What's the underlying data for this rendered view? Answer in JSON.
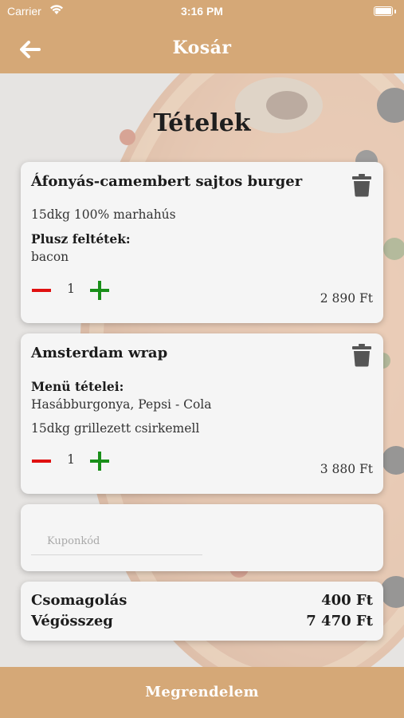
{
  "status_bar": {
    "carrier": "Carrier",
    "time": "3:16 PM"
  },
  "header": {
    "title": "Kosár",
    "back_icon": "arrow-left-icon"
  },
  "section_title": "Tételek",
  "items": [
    {
      "name": "Áfonyás-camembert sajtos burger",
      "description": "15dkg 100% marhahús",
      "extras_label": "Plusz feltétek:",
      "extras": "bacon",
      "quantity": "1",
      "price": "2 890 Ft"
    },
    {
      "name": "Amsterdam wrap",
      "menu_label": "Menü tételei:",
      "menu_items": "Hasábburgonya, Pepsi - Cola",
      "description": "15dkg grillezett csirkemell",
      "quantity": "1",
      "price": "3 880 Ft"
    }
  ],
  "coupon": {
    "placeholder": "Kuponkód",
    "value": ""
  },
  "summary": {
    "packaging_label": "Csomagolás",
    "packaging_value": "400 Ft",
    "total_label": "Végösszeg",
    "total_value": "7 470 Ft"
  },
  "footer": {
    "order_label": "Megrendelem"
  },
  "colors": {
    "accent": "#d5a877",
    "minus": "#e01010",
    "plus": "#1a8f1a",
    "trash": "#555555"
  }
}
